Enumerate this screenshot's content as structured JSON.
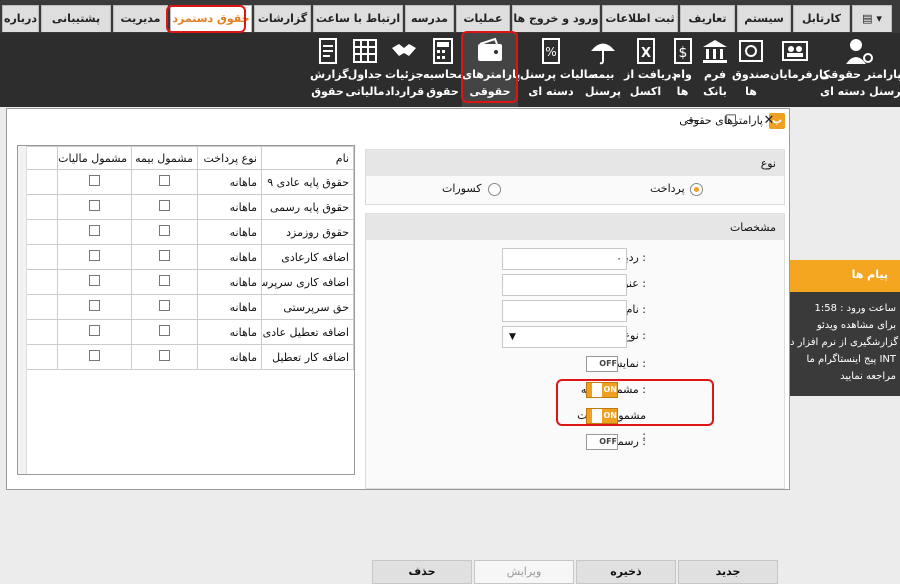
{
  "menu": {
    "tabs": [
      "کارتابل",
      "سیستم",
      "تعاریف",
      "ثبت اطلاعات",
      "ورود و خروج ها",
      "عملیات",
      "مدرسه",
      "ارتباط با ساعت",
      "گزارشات",
      "حقوق دستمزد",
      "مدیریت",
      "پشتیبانی",
      "درباره"
    ],
    "selected_tab": "حقوق دستمزد"
  },
  "ribbon": {
    "buttons": [
      {
        "line1": "پارامتر حقوقی",
        "line2": "پرسنل دسته ای",
        "icon": "person-gear-icon"
      },
      {
        "line1": "کارفرمایان",
        "line2": "",
        "icon": "employers-icon"
      },
      {
        "line1": "صندوق",
        "line2": "ها",
        "icon": "safe-icon"
      },
      {
        "line1": "فرم",
        "line2": "بانک",
        "icon": "bank-icon"
      },
      {
        "line1": "وام",
        "line2": "ها",
        "icon": "loan-icon"
      },
      {
        "line1": "دریافت از",
        "line2": "اکسل",
        "icon": "excel-icon"
      },
      {
        "line1": "بیمه",
        "line2": "پرسنل",
        "icon": "umbrella-icon"
      },
      {
        "line1": "مالیات پرسنل",
        "line2": "دسته ای",
        "icon": "tax-percent-icon"
      },
      {
        "line1": "پارامترهای",
        "line2": "حقوقی",
        "icon": "wallet-icon"
      },
      {
        "line1": "محاسبه",
        "line2": "حقوق",
        "icon": "calculator-icon"
      },
      {
        "line1": "جزئیات",
        "line2": "قرارداد",
        "icon": "handshake-icon"
      },
      {
        "line1": "جداول",
        "line2": "مالیاتی",
        "icon": "table-icon"
      },
      {
        "line1": "گزارش",
        "line2": "حقوق",
        "icon": "report-icon"
      }
    ]
  },
  "messages": {
    "title": "پیام ها",
    "lines": [
      "ساعت ورود : 1:58",
      "برای مشاهده ویدئو",
      "گزارشگیری از نرم افزار د",
      "پیج اینستاگرام ما INT",
      "مراجعه نمایید"
    ]
  },
  "window": {
    "title": "پارامترهای حقوقی",
    "app_icon": "پ",
    "grid": {
      "headers": [
        "نام",
        "نوع پرداخت",
        "مشمول بیمه",
        "مشمول مالیات"
      ],
      "rows": [
        {
          "name": "حقوق پایه عادی ۹",
          "type": "ماهانه"
        },
        {
          "name": "حقوق پایه رسمی",
          "type": "ماهانه"
        },
        {
          "name": "حقوق روزمزد",
          "type": "ماهانه"
        },
        {
          "name": "اضافه کارعادی",
          "type": "ماهانه"
        },
        {
          "name": "اضافه کاری سرپرست",
          "type": "ماهانه"
        },
        {
          "name": "حق سرپرستی",
          "type": "ماهانه"
        },
        {
          "name": "اضافه تعطیل عادی",
          "type": "ماهانه"
        },
        {
          "name": "اضافه کار تعطیل",
          "type": "ماهانه"
        }
      ]
    },
    "type_panel": {
      "title": "نوع",
      "option_pay": "پرداخت",
      "option_deduct": "کسورات",
      "selected": "پرداخت"
    },
    "specs": {
      "title": "مشخصات",
      "row_label": "ردیف :",
      "row_value": "۰",
      "title_label": "عنوان :",
      "name_label": "نام :",
      "paytype_label": "نوع پرداخت :",
      "display_label": "نمایش :",
      "insurance_label": "مشمول بیمه :",
      "tax_label": "مشمول مالیات :",
      "official_label": "رسمی :",
      "off_text": "OFF",
      "on_text": "ON",
      "display_state": "OFF",
      "insurance_state": "ON",
      "tax_state": "ON",
      "official_state": "OFF"
    },
    "buttons": {
      "new": "جدید",
      "save": "ذخیره",
      "edit": "ویرایش",
      "delete": "حذف"
    }
  },
  "colors": {
    "accent": "#f0a020",
    "highlight": "#dd1515",
    "menubar": "#3a3a3a",
    "ribbon": "#2d2d2d"
  }
}
